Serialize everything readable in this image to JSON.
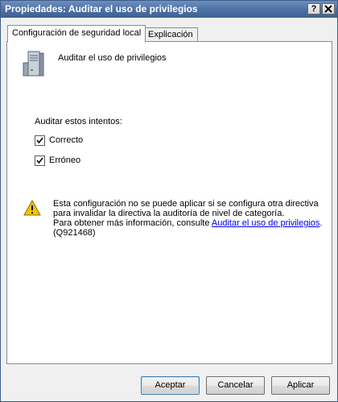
{
  "window": {
    "title": "Propiedades: Auditar el uso de privilegios",
    "help_button": "?",
    "close_button": "X"
  },
  "tabs": [
    {
      "label": "Configuración de seguridad local",
      "active": true
    },
    {
      "label": "Explicación",
      "active": false
    }
  ],
  "policy": {
    "name": "Auditar el uso de privilegios",
    "icon": "server-policy-icon"
  },
  "audit": {
    "label": "Auditar estos intentos:",
    "options": [
      {
        "label": "Correcto",
        "checked": true
      },
      {
        "label": "Erróneo",
        "checked": true
      }
    ]
  },
  "warning": {
    "icon": "warning-icon",
    "line1": "Esta configuración no se puede aplicar si se configura otra directiva",
    "line2": "para invalidar la directiva la auditoría de nivel de categoría.",
    "line3_prefix": "Para obtener más información, consulte ",
    "link_text": "Auditar el uso de privilegios",
    "line3_suffix": ".",
    "line4": "(Q921468)"
  },
  "buttons": {
    "ok": "Aceptar",
    "cancel": "Cancelar",
    "apply": "Aplicar"
  },
  "colors": {
    "titlebar": "#4f72a6",
    "link": "#0000ee",
    "warning": "#f5c400"
  }
}
